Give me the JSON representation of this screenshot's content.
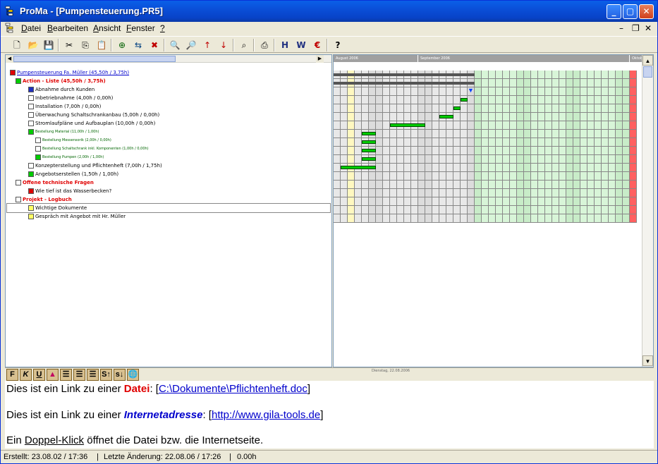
{
  "window": {
    "title": "ProMa - [Pumpensteuerung.PR5]"
  },
  "menu": [
    {
      "label": "Datei",
      "u": "D",
      "rest": "atei"
    },
    {
      "label": "Bearbeiten",
      "u": "B",
      "rest": "earbeiten"
    },
    {
      "label": "Ansicht",
      "u": "A",
      "rest": "nsicht"
    },
    {
      "label": "Fenster",
      "u": "F",
      "rest": "enster"
    },
    {
      "label": "?",
      "u": "?",
      "rest": ""
    }
  ],
  "toolbar_icons": [
    "new-file-icon",
    "open-folder-icon",
    "save-icon",
    "cut-icon",
    "copy-icon",
    "paste-icon",
    "add-item-icon",
    "insert-item-icon",
    "delete-item-icon",
    "zoom-in-icon",
    "zoom-out-icon",
    "sort-asc-icon",
    "sort-desc-icon",
    "search-icon",
    "print-icon",
    "export-html-icon",
    "export-doc-icon",
    "euro-icon",
    "help-icon"
  ],
  "tree": [
    {
      "text": "Pumpensteuerung Fa. Müller (45,50h / 3,75h)",
      "style": "lnk",
      "color": "#e00000",
      "indent": 0
    },
    {
      "text": "Action - Liste (45,50h / 3,75h)",
      "style": "red",
      "color": "#00cc00",
      "indent": 1
    },
    {
      "text": "Abnahme durch Kunden",
      "style": "",
      "color": "#2030c0",
      "indent": 2
    },
    {
      "text": "Inbetriebnahme (4,00h / 0,00h)",
      "style": "",
      "color": "#ffffff",
      "indent": 2
    },
    {
      "text": "Installation (7,00h / 0,00h)",
      "style": "",
      "color": "#ffffff",
      "indent": 2
    },
    {
      "text": "Überwachung Schaltschrankanbau (5,00h / 0,00h)",
      "style": "",
      "color": "#ffffff",
      "indent": 2
    },
    {
      "text": "Stromlaufpläne und Aufbauplan (10,00h / 0,00h)",
      "style": "",
      "color": "#ffffff",
      "indent": 2
    },
    {
      "text": "Bestellung Material (11,00h / 1,00h)",
      "style": "grn small",
      "color": "#00cc00",
      "indent": 2
    },
    {
      "text": "Bestellung Messensorik (2,00h / 0,00h)",
      "style": "grn small",
      "color": "#ffffff",
      "indent": 3
    },
    {
      "text": "Bestellung Schaltschrank inkl. Komponenten (1,00h / 0,00h)",
      "style": "grn small",
      "color": "#ffffff",
      "indent": 3
    },
    {
      "text": "Bestellung Pumpen (2,00h / 1,00h)",
      "style": "grn small",
      "color": "#00cc00",
      "indent": 3
    },
    {
      "text": "Konzepterstellung und Pflichtenheft (7,00h / 1,75h)",
      "style": "",
      "color": "#ffffff",
      "indent": 2
    },
    {
      "text": "Angebotserstellen (1,50h / 1,00h)",
      "style": "",
      "color": "#00cc00",
      "indent": 2
    },
    {
      "text": "Offene technische Fragen",
      "style": "red",
      "color": "#ffffff",
      "indent": 1
    },
    {
      "text": "Wie tief ist das Wasserbecken?",
      "style": "",
      "color": "#e00000",
      "indent": 2
    },
    {
      "text": "Projekt - Logbuch",
      "style": "red",
      "color": "#ffffff",
      "indent": 1
    },
    {
      "text": "Wichtige Dokumente",
      "style": "",
      "color": "#ffff66",
      "indent": 2
    },
    {
      "text": "Gespräch mit Angebot mit Hr. Müller",
      "style": "",
      "color": "#ffff66",
      "indent": 2
    }
  ],
  "gantt": {
    "months": [
      "August 2006",
      "September 2006",
      "Oktob"
    ],
    "status_date": "Dienstag, 22.08.2006"
  },
  "format_toolbar": [
    "F",
    "K",
    "U",
    "color",
    "align-left",
    "align-center",
    "align-right",
    "S↑",
    "s↓",
    "link"
  ],
  "notes": {
    "line1_pre": "Dies ist ein Link zu einer ",
    "line1_kw": "Datei",
    "line1_mid": ": [",
    "line1_link": "C:\\Dokumente\\Pflichtenheft.doc",
    "line1_post": "]",
    "line2_pre": "Dies ist ein Link zu einer ",
    "line2_kw": "Internetadresse",
    "line2_mid": ": [",
    "line2_link": "http://www.gila-tools.de",
    "line2_post": "]",
    "line3_pre": "Ein ",
    "line3_ul": "Doppel-Klick",
    "line3_post": " öffnet die Datei bzw. die Internetseite."
  },
  "status": {
    "created": "Erstellt: 23.08.02 / 17:36",
    "changed": "Letzte Änderung: 22.08.06 / 17:26",
    "hours": "0.00h"
  },
  "colors": {
    "titlebar": "#0a4fd8",
    "bar": "#00cc00",
    "today": "#ff6060"
  }
}
